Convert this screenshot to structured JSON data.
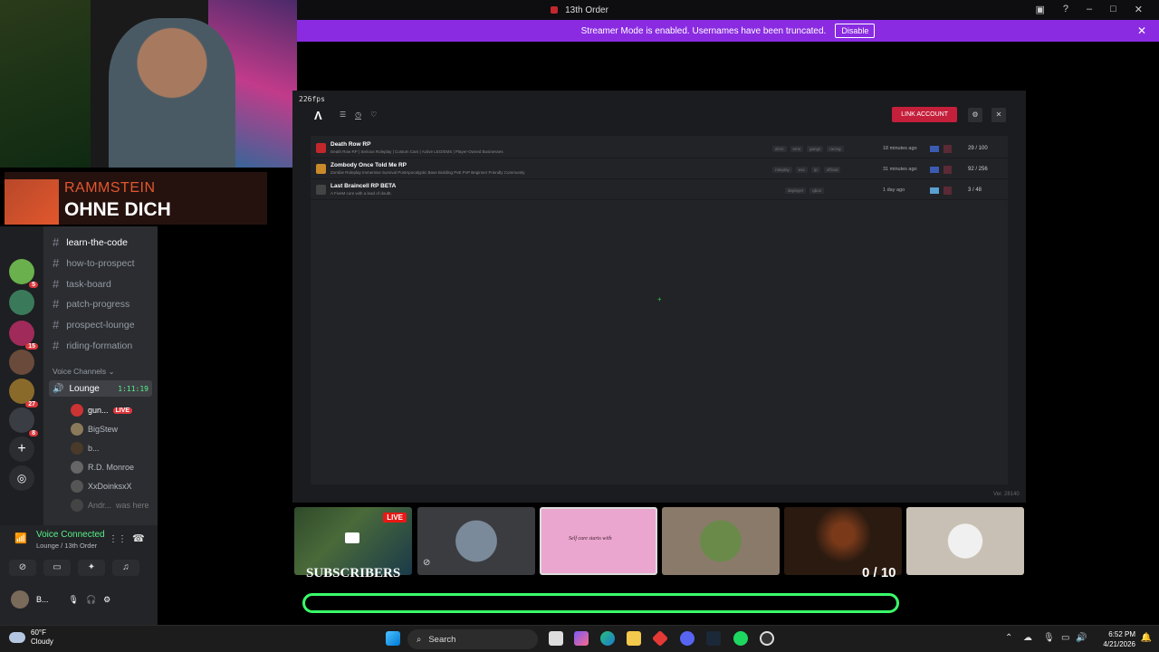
{
  "window": {
    "title": "13th Order"
  },
  "banner": {
    "text": "Streamer Mode is enabled. Usernames have been truncated.",
    "disable_label": "Disable"
  },
  "now_playing": {
    "artist": "RAMMSTEIN",
    "track": "OHNE DICH"
  },
  "discord": {
    "channels": [
      {
        "name": "learn-the-code",
        "active": true
      },
      {
        "name": "how-to-prospect",
        "active": false
      },
      {
        "name": "task-board",
        "active": false
      },
      {
        "name": "patch-progress",
        "active": false
      },
      {
        "name": "prospect-lounge",
        "active": false
      },
      {
        "name": "riding-formation",
        "active": false
      }
    ],
    "voice_header": "Voice Channels",
    "lounge": {
      "name": "Lounge",
      "timer": "1:11:19"
    },
    "voice_users": [
      {
        "name": "gun...",
        "badge": "LIVE"
      },
      {
        "name": "BigStew"
      },
      {
        "name": "b..."
      },
      {
        "name": "R.D. Monroe"
      },
      {
        "name": "XxDoinksxX"
      },
      {
        "name": "Andr...",
        "note": "was here"
      }
    ],
    "server_badges": [
      "5",
      "15",
      "27",
      "8"
    ],
    "voice_panel": {
      "status": "Voice Connected",
      "location": "Lounge / 13th Order",
      "user": "B..."
    }
  },
  "game": {
    "fps": "226fps",
    "link_account_label": "LINK ACCOUNT",
    "version": "Ver. 28140",
    "servers": [
      {
        "name": "Death Row RP",
        "desc": "Death Row RP | Serious Roleplay | Custom Cars | Active LEO/EMS | Player-Owned Businesses",
        "tags": [
          "dzcn",
          "ems",
          "gangs",
          "racing"
        ],
        "time": "18 minutes ago",
        "players": "29 / 100",
        "icon_color": "#c2272d"
      },
      {
        "name": "Zombody Once Told Me RP",
        "desc": "Zombie Roleplay Immersive Survival PostApocalyptic Base Building PvE PvP Beginner Friendly Community",
        "tags": [
          "roleplay",
          "esx",
          "rp",
          "official"
        ],
        "time": "31 minutes ago",
        "players": "92 / 256",
        "icon_color": "#c98a2a"
      },
      {
        "name": "Last Braincell RP BETA",
        "desc": "A FiveM core with a lead of doubt.",
        "tags": [
          "deployer",
          "qbox"
        ],
        "time": "1 day ago",
        "players": "3 / 48",
        "icon_color": "#444"
      }
    ]
  },
  "overlay": {
    "subscribers_label": "SUBSCRIBERS",
    "live_label": "LIVE",
    "count": "0 / 10",
    "card_text": "Self care starts with"
  },
  "taskbar": {
    "temp": "60°F",
    "condition": "Cloudy",
    "search_placeholder": "Search",
    "time": "6:52 PM",
    "date": "4/21/2026"
  },
  "colors": {
    "banner": "#8a2be2",
    "link_button": "#c4203b",
    "progress_border": "#39ff6a",
    "discord_green": "#57f287"
  }
}
